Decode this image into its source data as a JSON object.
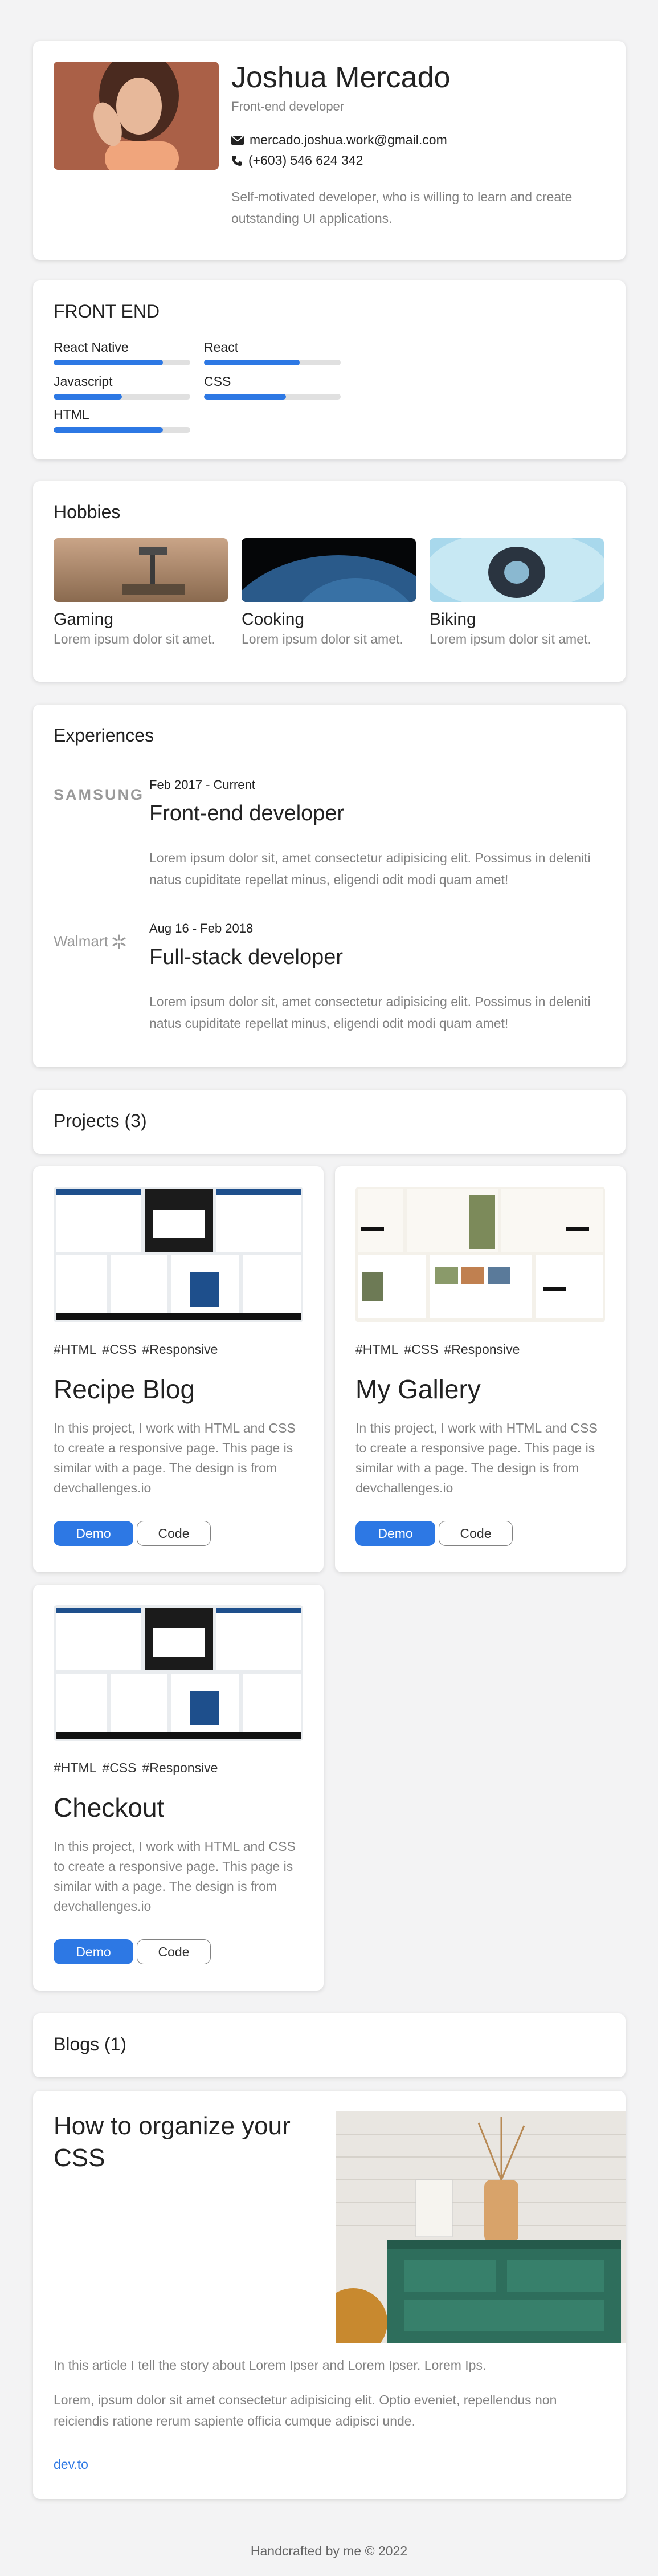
{
  "profile": {
    "name": "Joshua Mercado",
    "role": "Front-end developer",
    "email": "mercado.joshua.work@gmail.com",
    "phone": "(+603) 546 624 342",
    "bio": "Self-motivated developer, who is willing to learn and create outstanding UI applications."
  },
  "skills": {
    "title": "FRONT END",
    "items": [
      {
        "label": "React Native",
        "level": 0.8
      },
      {
        "label": "React",
        "level": 0.7
      },
      {
        "label": "Javascript",
        "level": 0.5
      },
      {
        "label": "CSS",
        "level": 0.6
      },
      {
        "label": "HTML",
        "level": 0.8
      }
    ]
  },
  "hobbies": {
    "title": "Hobbies",
    "items": [
      {
        "name": "Gaming",
        "desc": "Lorem ipsum dolor sit amet."
      },
      {
        "name": "Cooking",
        "desc": "Lorem ipsum dolor sit amet."
      },
      {
        "name": "Biking",
        "desc": "Lorem ipsum dolor sit amet."
      }
    ]
  },
  "experiences": {
    "title": "Experiences",
    "items": [
      {
        "company": "SAMSUNG",
        "date": "Feb 2017 - Current",
        "title": "Front-end developer",
        "desc": "Lorem ipsum dolor sit, amet consectetur adipisicing elit. Possimus in deleniti natus cupiditate repellat minus, eligendi odit modi quam amet!"
      },
      {
        "company": "Walmart",
        "date": "Aug 16 - Feb 2018",
        "title": "Full-stack developer",
        "desc": "Lorem ipsum dolor sit, amet consectetur adipisicing elit. Possimus in deleniti natus cupiditate repellat minus, eligendi odit modi quam amet!"
      }
    ]
  },
  "projects": {
    "title": "Projects (3)",
    "items": [
      {
        "tags": [
          "#HTML",
          "#CSS",
          "#Responsive"
        ],
        "title": "Recipe Blog",
        "desc": "In this project, I work with HTML and CSS to create a responsive page. This page is similar with a page. The design is from devchallenges.io",
        "demo": "Demo",
        "code": "Code"
      },
      {
        "tags": [
          "#HTML",
          "#CSS",
          "#Responsive"
        ],
        "title": "My Gallery",
        "desc": "In this project, I work with HTML and CSS to create a responsive page. This page is similar with a page. The design is from devchallenges.io",
        "demo": "Demo",
        "code": "Code"
      },
      {
        "tags": [
          "#HTML",
          "#CSS",
          "#Responsive"
        ],
        "title": "Checkout",
        "desc": "In this project, I work with HTML and CSS to create a responsive page. This page is similar with a page. The design is from devchallenges.io",
        "demo": "Demo",
        "code": "Code"
      }
    ]
  },
  "blogs": {
    "title": "Blogs (1)",
    "post": {
      "title": "How to organize your CSS",
      "intro": "In this article I tell the story about Lorem Ipser and Lorem Ipser. Lorem Ips.",
      "body": "Lorem, ipsum dolor sit amet consectetur adipisicing elit. Optio eveniet, repellendus non reiciendis ratione rerum sapiente officia cumque adipisci unde.",
      "source": "dev.to"
    }
  },
  "footer": "Handcrafted by me © 2022",
  "colors": {
    "accent": "#2d78e4",
    "muted": "#828282",
    "background": "#f3f3f4"
  }
}
